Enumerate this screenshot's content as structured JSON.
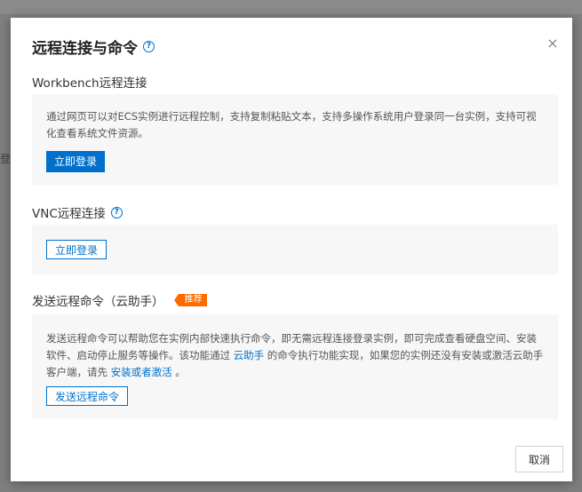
{
  "background": {
    "partial_text": "登录"
  },
  "dialog": {
    "title": "远程连接与命令",
    "close_symbol": "×",
    "sections": {
      "workbench": {
        "title": "Workbench远程连接",
        "description": "通过网页可以对ECS实例进行远程控制，支持复制粘贴文本，支持多操作系统用户登录同一台实例，支持可视化查看系统文件资源。",
        "button": "立即登录"
      },
      "vnc": {
        "title": "VNC远程连接",
        "button": "立即登录"
      },
      "command": {
        "title": "发送远程命令（云助手）",
        "badge": "推荐",
        "desc_part1": "发送远程命令可以帮助您在实例内部快速执行命令，即无需远程连接登录实例，即可完成查看硬盘空间、安装软件、启动停止服务等操作。该功能通过 ",
        "desc_link1": "云助手",
        "desc_part2": " 的命令执行功能实现，如果您的实例还没有安装或激活云助手客户端，请先 ",
        "desc_link2": "安装或者激活",
        "desc_part3": " 。",
        "button": "发送远程命令"
      }
    },
    "cancel": "取消"
  }
}
